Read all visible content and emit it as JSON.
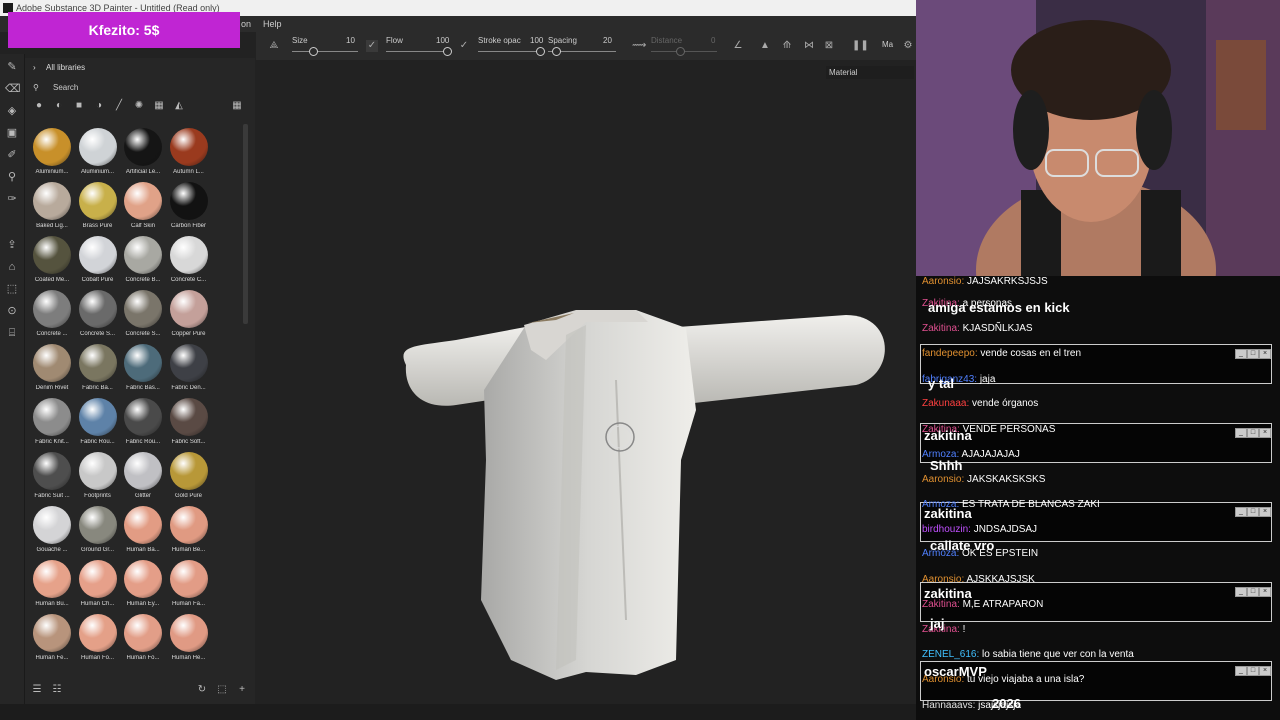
{
  "window": {
    "title": "Adobe Substance 3D Painter - Untitled (Read only)"
  },
  "menu": {
    "items": [
      "on",
      "Help"
    ]
  },
  "donation": {
    "text": "Kfezito: 5$"
  },
  "properties": {
    "size_label": "Size",
    "size_value": "10",
    "flow_label": "Flow",
    "flow_value": "100",
    "stroke_label": "Stroke opac",
    "stroke_value": "100",
    "spacing_label": "Spacing",
    "spacing_value": "20",
    "distance_label": "Distance",
    "distance_value": "0",
    "mode_label": "Ma"
  },
  "viewport": {
    "channel_select": "Material"
  },
  "shelf": {
    "header": "All libraries",
    "search_placeholder": "Search",
    "materials": [
      {
        "label": "Aluminium...",
        "color": "#c8902a"
      },
      {
        "label": "Aluminium...",
        "color": "#cfd3d6"
      },
      {
        "label": "Artificial Le...",
        "color": "#151515"
      },
      {
        "label": "Autumn L...",
        "color": "#9a3a1e"
      },
      {
        "label": "Baked Lig...",
        "color": "#b8aa9c"
      },
      {
        "label": "Brass Pure",
        "color": "#c8b04a"
      },
      {
        "label": "Calf Skin",
        "color": "#e0a288"
      },
      {
        "label": "Carbon Fiber",
        "color": "#121212"
      },
      {
        "label": "Coated Me...",
        "color": "#55533e"
      },
      {
        "label": "Cobalt Pure",
        "color": "#d2d4d8"
      },
      {
        "label": "Concrete B...",
        "color": "#a8a8a2"
      },
      {
        "label": "Concrete C...",
        "color": "#d8d8d8"
      },
      {
        "label": "Concrete ...",
        "color": "#7d7d7d"
      },
      {
        "label": "Concrete S...",
        "color": "#6a6a6a"
      },
      {
        "label": "Concrete S...",
        "color": "#7a756a"
      },
      {
        "label": "Copper Pure",
        "color": "#c4a09a"
      },
      {
        "label": "Denim Rivet",
        "color": "#a08a72"
      },
      {
        "label": "Fabric Ba...",
        "color": "#7a7660"
      },
      {
        "label": "Fabric Bas...",
        "color": "#4d6b7a"
      },
      {
        "label": "Fabric Den...",
        "color": "#3e4046"
      },
      {
        "label": "Fabric Knit...",
        "color": "#8c8c8c"
      },
      {
        "label": "Fabric Rou...",
        "color": "#5e82a8"
      },
      {
        "label": "Fabric Rou...",
        "color": "#4a4a4a"
      },
      {
        "label": "Fabric Soft...",
        "color": "#5a4a44"
      },
      {
        "label": "Fabric Suit ...",
        "color": "#4e4e4e"
      },
      {
        "label": "Footprints",
        "color": "#c8c8c8"
      },
      {
        "label": "Glitter",
        "color": "#c0c0c4"
      },
      {
        "label": "Gold Pure",
        "color": "#b89838"
      },
      {
        "label": "Gouache ...",
        "color": "#d4d4d6"
      },
      {
        "label": "Ground Gr...",
        "color": "#88887e"
      },
      {
        "label": "Human Ba...",
        "color": "#e29c84"
      },
      {
        "label": "Human Be...",
        "color": "#e09a82"
      },
      {
        "label": "Human Bu...",
        "color": "#e6a28a"
      },
      {
        "label": "Human Ch...",
        "color": "#e6a08a"
      },
      {
        "label": "Human Ey...",
        "color": "#e49e88"
      },
      {
        "label": "Human Fa...",
        "color": "#e29c86"
      },
      {
        "label": "Human Fe...",
        "color": "#b8947c"
      },
      {
        "label": "Human Fo...",
        "color": "#e4a088"
      },
      {
        "label": "Human Fo...",
        "color": "#e29e88"
      },
      {
        "label": "Human He...",
        "color": "#e09a84"
      }
    ]
  },
  "chat": {
    "lines": [
      {
        "user": "Aaronsio:",
        "color": "#e09030",
        "text": "JAJSAKRKSJSJS"
      },
      {
        "user": "Zakitina:",
        "color": "#e05090",
        "text": "a personas"
      },
      {
        "user": "Zakitina:",
        "color": "#e05090",
        "text": "KJASDÑLKJAS"
      },
      {
        "user": "fandepeepo:",
        "color": "#e09030",
        "text": "vende cosas en el tren"
      },
      {
        "user": "fabriganz43:",
        "color": "#5080ff",
        "text": "jaja"
      },
      {
        "user": "Zakunaaa:",
        "color": "#ff4040",
        "text": "vende órganos"
      },
      {
        "user": "Zakitina:",
        "color": "#e05090",
        "text": "VENDE PERSONAS"
      },
      {
        "user": "Armoza:",
        "color": "#5080ff",
        "text": "AJAJAJAJAJ"
      },
      {
        "user": "Aaronsio:",
        "color": "#e09030",
        "text": "JAKSKAKSKSKS"
      },
      {
        "user": "Armoza:",
        "color": "#5080ff",
        "text": "ES TRATA DE BLANCAS ZAKI"
      },
      {
        "user": "birdhouzin:",
        "color": "#c050ff",
        "text": "JNDSAJDSAJ"
      },
      {
        "user": "Armoza:",
        "color": "#5080ff",
        "text": "OK ES EPSTEIN"
      },
      {
        "user": "Aaronsio:",
        "color": "#e09030",
        "text": "AJSKKAJSJSK"
      },
      {
        "user": "Zakitina:",
        "color": "#e05090",
        "text": "M,E ATRAPARON"
      },
      {
        "user": "Zakitina:",
        "color": "#e05090",
        "text": "!"
      },
      {
        "user": "ZENEL_616:",
        "color": "#40c0ff",
        "text": "lo sabia tiene que ver con la venta"
      },
      {
        "user": "Aaronsio:",
        "color": "#e09030",
        "text": "tu viejo viajaba a una isla?"
      },
      {
        "user": "Hannaaavs:",
        "color": "#e0e0e0",
        "text": "jsajsjajsja"
      }
    ],
    "overlays": [
      {
        "text": "amiga estamos en kick"
      },
      {
        "text": "y tal"
      },
      {
        "text": "zakitina"
      },
      {
        "text": "Shhh"
      },
      {
        "text": "zakitina"
      },
      {
        "text": "callate vro"
      },
      {
        "text": "zakitina"
      },
      {
        "text": "jaj"
      },
      {
        "text": "oscarMVP"
      },
      {
        "text": "2026"
      }
    ]
  }
}
